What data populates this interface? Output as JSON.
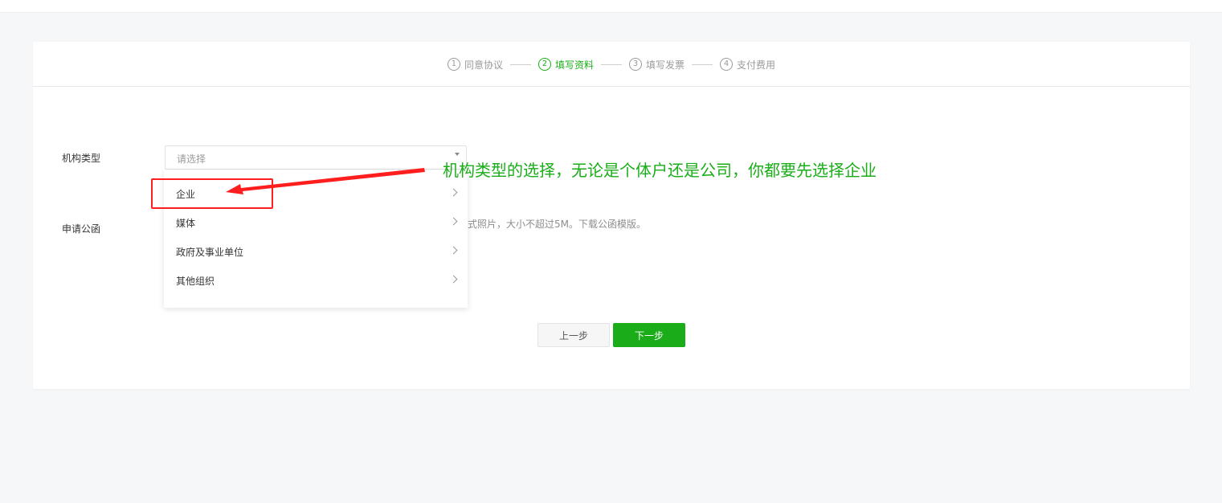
{
  "steps": [
    {
      "num": "1",
      "label": "同意协议",
      "active": false
    },
    {
      "num": "2",
      "label": "填写资料",
      "active": true
    },
    {
      "num": "3",
      "label": "填写发票",
      "active": false
    },
    {
      "num": "4",
      "label": "支付费用",
      "active": false
    }
  ],
  "form": {
    "org_type_label": "机构类型",
    "org_type_placeholder": "请选择",
    "letter_label": "申请公函",
    "letter_hint": "式照片，大小不超过5M。下载公函模版。"
  },
  "dropdown": {
    "items": [
      "企业",
      "媒体",
      "政府及事业单位",
      "其他组织"
    ]
  },
  "buttons": {
    "prev": "上一步",
    "next": "下一步"
  },
  "annotation": {
    "text": "机构类型的选择，无论是个体户还是公司，你都要先选择企业"
  },
  "colors": {
    "accent": "#1aad19",
    "annotation_red": "#ff1e1e"
  }
}
